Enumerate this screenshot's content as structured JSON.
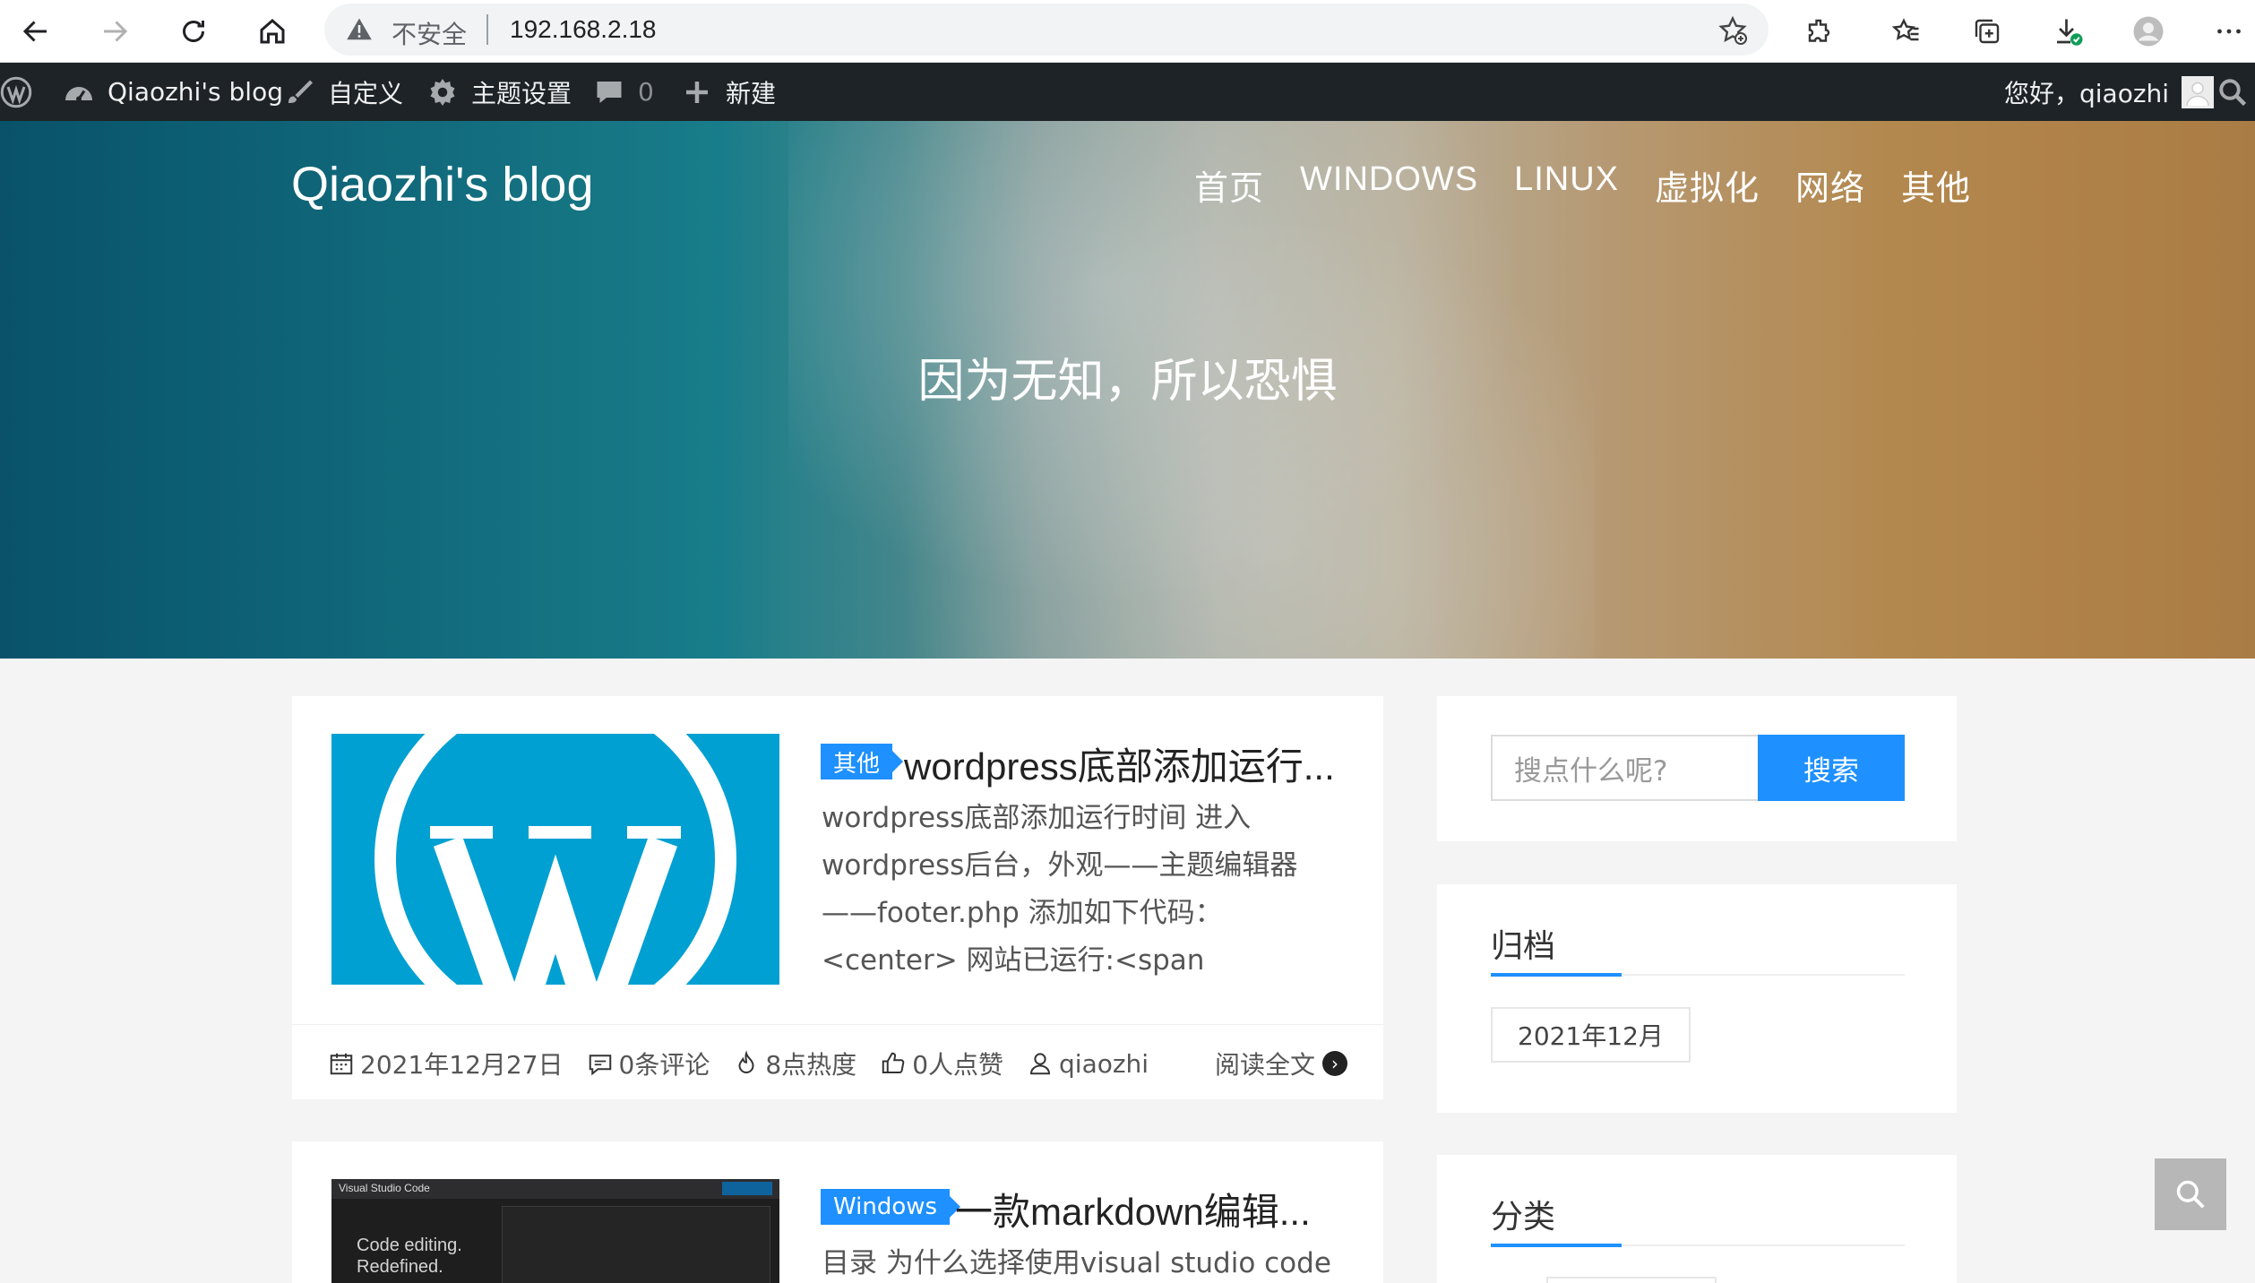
{
  "browser": {
    "security_label": "不安全",
    "url": "192.168.2.18"
  },
  "admin_bar": {
    "site_name": "Qiaozhi's blog",
    "customize": "自定义",
    "theme_settings": "主题设置",
    "comments_count": "0",
    "new": "新建",
    "greeting": "您好，qiaozhi"
  },
  "header": {
    "site_title": "Qiaozhi's blog",
    "nav": [
      "首页",
      "WINDOWS",
      "LINUX",
      "虚拟化",
      "网络",
      "其他"
    ],
    "tagline": "因为无知，所以恐惧"
  },
  "posts": [
    {
      "category": "其他",
      "title": "wordpress底部添加运行...",
      "excerpt": "wordpress底部添加运行时间 进入wordpress后台，外观——主题编辑器——footer.php 添加如下代码： <center> 网站已运行:<span id=\"run_time\" style=\"col...",
      "date": "2021年12月27日",
      "comments": "0条评论",
      "views": "8点热度",
      "likes": "0人点赞",
      "author": "qiaozhi",
      "read_more": "阅读全文"
    },
    {
      "category": "Windows",
      "title": "一款markdown编辑...",
      "excerpt": "目录 为什么选择使用visual studio code",
      "thumb_text_1": "Code editing.",
      "thumb_text_2": "Redefined.",
      "thumb_brand": "Visual Studio Code"
    }
  ],
  "sidebar": {
    "search_placeholder": "搜点什么呢?",
    "search_button": "搜索",
    "archive_title": "归档",
    "archive_items": [
      "2021年12月"
    ],
    "category_title": "分类"
  },
  "colors": {
    "accent": "#1e90ff",
    "admin_bar": "#1d2327",
    "wp_blue": "#00a0d2"
  }
}
